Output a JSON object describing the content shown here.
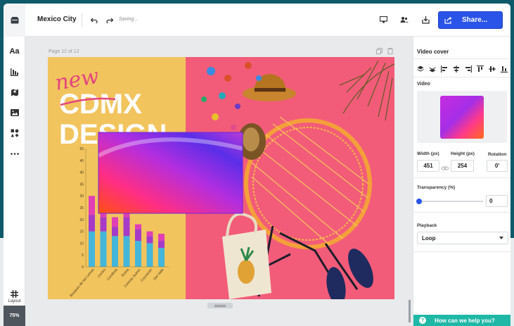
{
  "header": {
    "title": "Mexico City",
    "saving": "Saving...",
    "share_label": "Share..."
  },
  "icons": {
    "undo": "undo-icon",
    "redo": "redo-icon",
    "preview": "monitor-icon",
    "collaborate": "people-icon",
    "download": "download-icon",
    "share": "share-icon"
  },
  "leftbar": {
    "text_label": "Aa",
    "layout_label": "Layout",
    "zoom": "75%"
  },
  "canvas": {
    "page_label": "Page 12 of 12",
    "design_text": {
      "script_word": "new",
      "line1": "CDMX",
      "line2": "DESIGN"
    }
  },
  "chart_data": {
    "type": "bar",
    "categories": [
      "Bosques de las Lomas",
      "Centro",
      "Condesa",
      "Roma",
      "Colonia Juarez",
      "Coyoacan",
      "Del Valle"
    ],
    "ylim": [
      0,
      50
    ],
    "yticks": [
      "50",
      "45",
      "40",
      "35",
      "30",
      "25",
      "20",
      "15",
      "10",
      "5",
      "0"
    ],
    "series": [
      {
        "values": [
          15,
          15,
          13,
          13,
          11,
          10,
          8
        ]
      },
      {
        "values": [
          7,
          6,
          4,
          8,
          5,
          3,
          3
        ]
      },
      {
        "values": [
          8,
          4,
          4,
          3,
          2,
          2,
          3
        ]
      }
    ],
    "colors": [
      "#44b6d9",
      "#a63bc8",
      "#e03fb5"
    ]
  },
  "right_panel": {
    "title": "Video cover",
    "video_label": "Video",
    "width_label": "Width (px)",
    "height_label": "Height (px)",
    "rotation_label": "Rotation",
    "width_value": "451",
    "height_value": "254",
    "rotation_value": "0'",
    "transparency_label": "Transparency (%)",
    "transparency_value": "0",
    "playback_label": "Playback",
    "playback_value": "Loop"
  },
  "help": {
    "label": "How can we help you?"
  }
}
